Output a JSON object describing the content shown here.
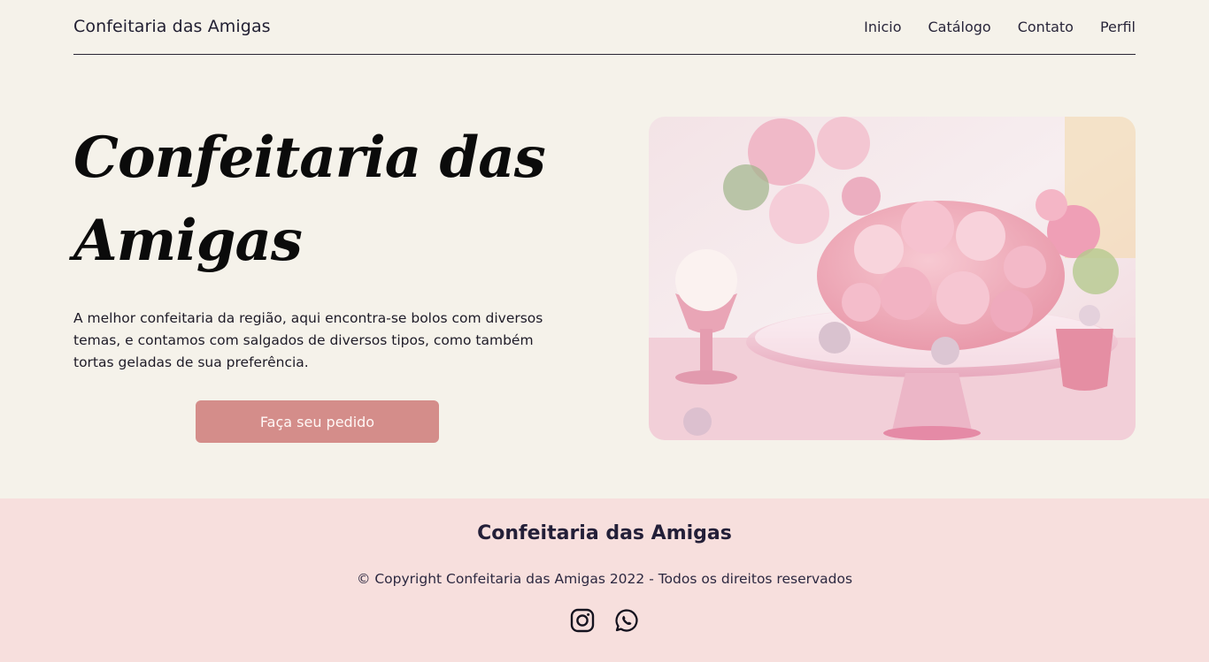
{
  "header": {
    "brand": "Confeitaria das Amigas",
    "nav": [
      "Inicio",
      "Catálogo",
      "Contato",
      "Perfil"
    ]
  },
  "hero": {
    "title": "Confeitaria das Amigas",
    "description": "A melhor confeitaria da região, aqui encontra-se bolos com diversos temas, e contamos com salgados de diversos tipos, como também tortas geladas de sua preferência.",
    "cta_label": "Faça seu pedido"
  },
  "footer": {
    "title": "Confeitaria das Amigas",
    "copyright": "© Copyright Confeitaria das Amigas 2022 - Todos os direitos reservados",
    "socials": [
      "instagram-icon",
      "whatsapp-icon"
    ]
  },
  "colors": {
    "background": "#f5f2ea",
    "button": "#d48d8a",
    "footer_bg": "#f7dfdd",
    "text_dark": "#231f38"
  }
}
